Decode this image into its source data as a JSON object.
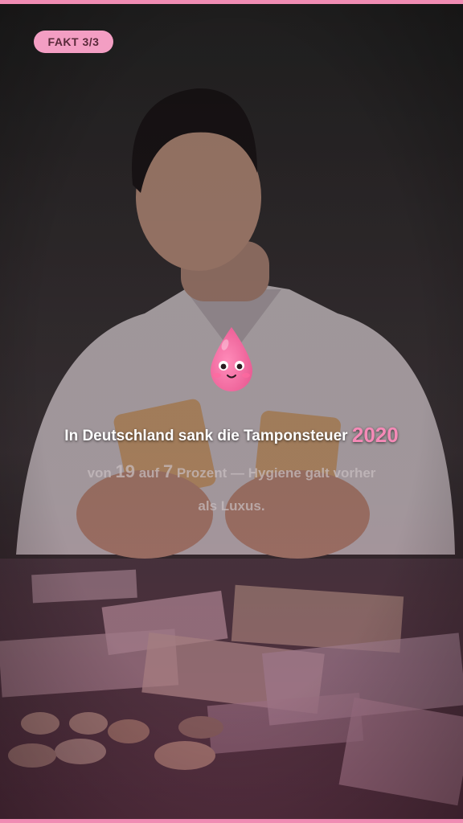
{
  "badge": {
    "label": "FAKT 3/3"
  },
  "mascot": {
    "icon": "blood-drop-mascot-icon",
    "color": "#f06a9f"
  },
  "headline": {
    "text": "In Deutschland sank die Tamponsteuer",
    "year": "2020"
  },
  "subline": {
    "part1": "von ",
    "num1": "19",
    "part2": " auf ",
    "num2": "7",
    "part3": " Prozent — Hygiene galt vorher",
    "line2": "als Luxus."
  },
  "colors": {
    "accent": "#f08cb3",
    "year": "#f58ab7",
    "badge_bg": "#f39ec3"
  }
}
